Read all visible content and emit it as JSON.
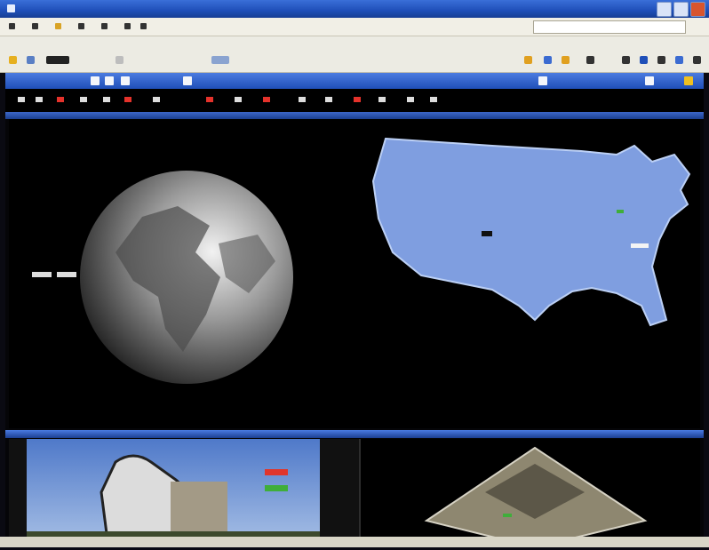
{
  "window": {
    "buttons": [
      "minimize-button",
      "maximize-button",
      "close-button"
    ]
  },
  "colors": {
    "titlebar": "#1f4fb8",
    "map_land": "#7f9ee0",
    "map_background": "#000000",
    "legend_red": "#e0352b",
    "legend_green": "#3fae3a"
  },
  "panels": {
    "globe": {
      "icon": "globe-3d-view"
    },
    "map": {
      "icon": "usa-map-view"
    },
    "photo": {
      "icon": "radar-dome-photo"
    },
    "terrain": {
      "icon": "3d-terrain-view"
    }
  }
}
